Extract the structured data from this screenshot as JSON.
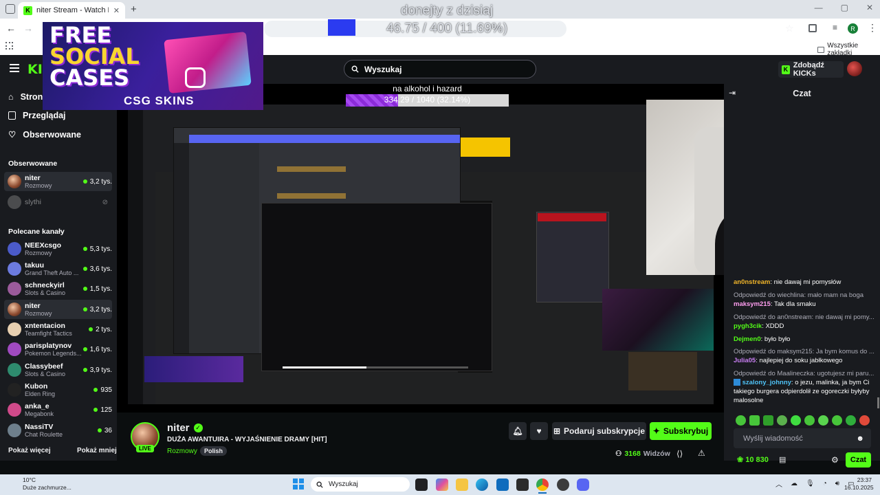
{
  "browser": {
    "tab_title": "niter Stream - Watch Live on Ki",
    "tab_favicon": "K",
    "bookmarks_all": "Wszystkie zakładki",
    "profile_initial": "R"
  },
  "overlay": {
    "donation_title": "donejty z dzisiaj",
    "donation_value": "46.75 / 400 (11.69%)",
    "goal2_title": "na alkohol i hazard",
    "goal2_value": "334.29 / 1040 (32.14%)",
    "goal2_progress": 0.3214,
    "ad_line1": "FREE",
    "ad_line2": "SOCIAL",
    "ad_line3": "CASES",
    "ad_brand": "CSG SKINS"
  },
  "topnav": {
    "search_placeholder": "Wyszukaj",
    "get_kicks": "Zdobądź KICKs"
  },
  "sidebar": {
    "nav": [
      {
        "label": "Strona główna"
      },
      {
        "label": "Przeglądaj"
      },
      {
        "label": "Obserwowane"
      }
    ],
    "followed_heading": "Obserwowane",
    "followed": [
      {
        "name": "niter",
        "category": "Rozmowy",
        "viewers": "3,2 tys."
      },
      {
        "name": "slythi",
        "category": "",
        "viewers": ""
      }
    ],
    "recommended_heading": "Polecane kanały",
    "recommended": [
      {
        "name": "NEEXcsgo",
        "category": "Rozmowy",
        "viewers": "5,3 tys."
      },
      {
        "name": "takuu",
        "category": "Grand Theft Auto ...",
        "viewers": "3,6 tys."
      },
      {
        "name": "schneckyirl",
        "category": "Slots & Casino",
        "viewers": "1,5 tys."
      },
      {
        "name": "niter",
        "category": "Rozmowy",
        "viewers": "3,2 tys."
      },
      {
        "name": "xntentacion",
        "category": "Teamfight Tactics",
        "viewers": "2 tys."
      },
      {
        "name": "parisplatynov",
        "category": "Pokemon Legends...",
        "viewers": "1,6 tys."
      },
      {
        "name": "Classybeef",
        "category": "Slots & Casino",
        "viewers": "3,9 tys."
      },
      {
        "name": "Kubon",
        "category": "Elden Ring",
        "viewers": "935"
      },
      {
        "name": "anka_e",
        "category": "Megabonk",
        "viewers": "125"
      },
      {
        "name": "NassiTV",
        "category": "Chat Roulette",
        "viewers": "36"
      }
    ],
    "show_more": "Pokaż więcej",
    "show_less": "Pokaż mniej"
  },
  "stream": {
    "channel": "niter",
    "live_badge": "LIVE",
    "title": "DUŻA AWANTUIRA - WYJAŚNIENIE DRAMY [HIT]",
    "category": "Rozmowy",
    "language_tag": "Polish",
    "gift_button": "Podaruj subskrypcje",
    "subscribe_button": "Subskrybuj",
    "viewers_count": "3168",
    "viewers_label": "Widzów"
  },
  "chat": {
    "header": "Czat",
    "messages": [
      {
        "reply": "",
        "user": "an0nstream",
        "user_color": "#f0b429",
        "text": "nie dawaj mi pomysłów"
      },
      {
        "reply": "Odpowiedź do wiechlina: mało mam na boga",
        "user": "maksym215",
        "user_color": "#ff9ef0",
        "text": "Tak dla smaku"
      },
      {
        "reply": "Odpowiedź do an0nstream: nie dawaj mi pomy...",
        "user": "pygh3cik",
        "user_color": "#53fc18",
        "text": "XDDD"
      },
      {
        "reply": "",
        "user": "Dejmen0",
        "user_color": "#53fc18",
        "text": "było było"
      },
      {
        "reply": "Odpowiedź do maksym215: Ja bym komus do ...",
        "user": "Julia05",
        "user_color": "#c87ef2",
        "text": "najlepiej do soku jabłkowego"
      },
      {
        "reply": "Odpowiedź do Maalineczka: ugotujesz mi paru...",
        "user": "szalony_johnny",
        "user_color": "#4fc3f7",
        "text": "o jezu, malinka, ja bym Ci takiego burgera odpierdolił ze ogoreczki byłyby malosolne"
      }
    ],
    "input_placeholder": "Wyślij wiadomość",
    "points": "10 830",
    "send_button": "Czat"
  },
  "taskbar": {
    "weather_temp": "10°C",
    "weather_desc": "Duże zachmurze...",
    "search_placeholder": "Wyszukaj",
    "time": "23:37",
    "date": "16.10.2025"
  },
  "colors": {
    "kick_green": "#53fc18",
    "panel": "#191b1f",
    "page": "#0b0e0f"
  }
}
